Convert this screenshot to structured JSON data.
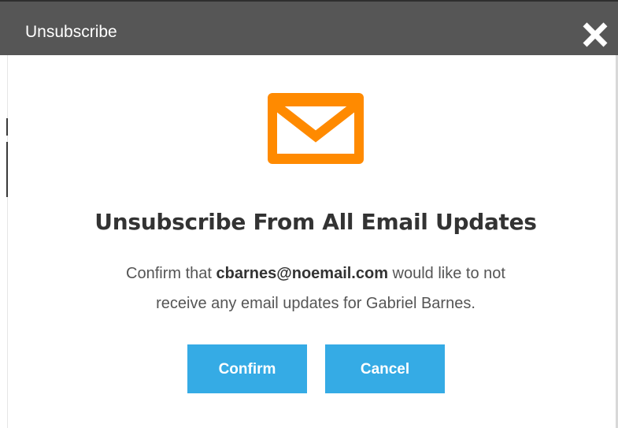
{
  "dialog": {
    "title": "Unsubscribe",
    "close_icon": "close-icon"
  },
  "content": {
    "icon": "envelope-icon",
    "icon_color": "#ff8a00",
    "heading": "Unsubscribe From All Email Updates",
    "message_prefix": "Confirm that ",
    "email": "cbarnes@noemail.com",
    "message_line1_suffix": " would like to not",
    "message_line2": "receive any email updates for Gabriel Barnes."
  },
  "buttons": {
    "confirm_label": "Confirm",
    "cancel_label": "Cancel",
    "color": "#35abe5"
  },
  "colors": {
    "titlebar": "#565656"
  }
}
